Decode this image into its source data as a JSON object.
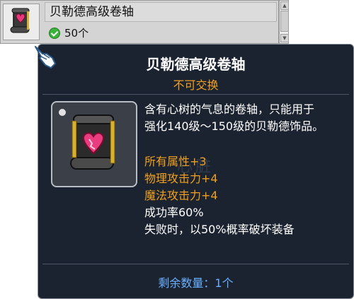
{
  "item": {
    "name": "贝勒德高级卷轴",
    "quantity": "50个"
  },
  "tooltip": {
    "title": "贝勒德高级卷轴",
    "trade_status": "不可交换",
    "description_line1": "含有心树的气息的卷轴，只能用于",
    "description_line2": "强化140级～150级的贝勒德饰品。",
    "watermark": "心脏",
    "stats": [
      {
        "label": "所有属性+3",
        "color": "orange"
      },
      {
        "label": "物理攻击力+4",
        "color": "orange"
      },
      {
        "label": "魔法攻击力+4",
        "color": "orange"
      },
      {
        "label": "成功率60%",
        "color": "white"
      },
      {
        "label": "失败时，以50%概率破坏装备",
        "color": "white"
      }
    ],
    "remaining_label": "剩余数量：1个"
  },
  "icons": {
    "row_icon": "scroll-heart-icon",
    "check": "check-circle-icon",
    "cursor": "hand-cursor-icon"
  },
  "colors": {
    "tooltip_bg": "#1c2330",
    "title": "#ffffff",
    "trade_status": "#f0a020",
    "stat_bonus": "#f0a020",
    "remaining": "#6ab0ff"
  }
}
